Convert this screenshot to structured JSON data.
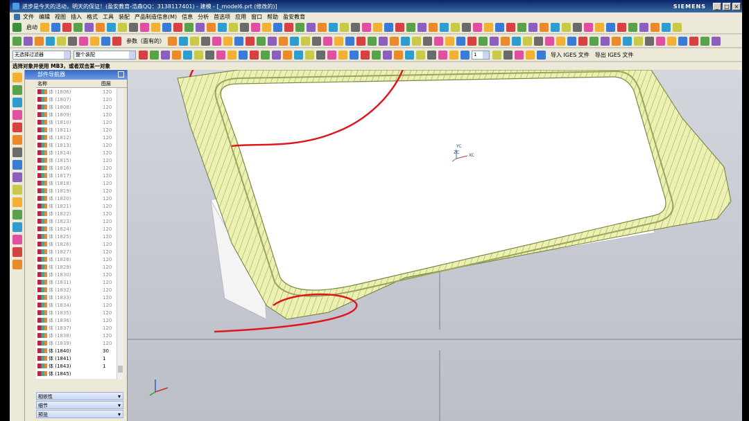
{
  "window": {
    "title": "进步是今天的活动，明天的保证！(盈安教育-浩森QQ：3138117401) - 建模 - [_model6.prt (修改的)]",
    "brand": "SIEMENS"
  },
  "menu": [
    "文件",
    "编辑",
    "视图",
    "插入",
    "格式",
    "工具",
    "装配",
    "产品制造信息(M)",
    "信息",
    "分析",
    "首选项",
    "应用",
    "窗口",
    "帮助",
    "盈安教育"
  ],
  "toolbar": {
    "start_label": "启动",
    "params_label": "参数（面有的）",
    "filter_value": "无选择过滤器",
    "assembly_value": "整个装配",
    "layer_value": "1",
    "import_iges": "导入 IGES 文件",
    "export_iges": "导出 IGES 文件"
  },
  "status_prompt": "选择对象并使用 MB3，或者双击某一对象",
  "navigator": {
    "title": "部件导航器",
    "col_name": "名称",
    "col_layer": "图层",
    "rows": [
      {
        "name": "体 (1806)",
        "layer": "120"
      },
      {
        "name": "体 (1807)",
        "layer": "120"
      },
      {
        "name": "体 (1808)",
        "layer": "120"
      },
      {
        "name": "体 (1809)",
        "layer": "120"
      },
      {
        "name": "体 (1810)",
        "layer": "120"
      },
      {
        "name": "体 (1811)",
        "layer": "120"
      },
      {
        "name": "体 (1812)",
        "layer": "120"
      },
      {
        "name": "体 (1813)",
        "layer": "120"
      },
      {
        "name": "体 (1814)",
        "layer": "120"
      },
      {
        "name": "体 (1815)",
        "layer": "120"
      },
      {
        "name": "体 (1816)",
        "layer": "120"
      },
      {
        "name": "体 (1817)",
        "layer": "120"
      },
      {
        "name": "体 (1818)",
        "layer": "120"
      },
      {
        "name": "体 (1819)",
        "layer": "120"
      },
      {
        "name": "体 (1820)",
        "layer": "120"
      },
      {
        "name": "体 (1821)",
        "layer": "120"
      },
      {
        "name": "体 (1822)",
        "layer": "120"
      },
      {
        "name": "体 (1823)",
        "layer": "120"
      },
      {
        "name": "体 (1824)",
        "layer": "120"
      },
      {
        "name": "体 (1825)",
        "layer": "120"
      },
      {
        "name": "体 (1826)",
        "layer": "120"
      },
      {
        "name": "体 (1827)",
        "layer": "120"
      },
      {
        "name": "体 (1828)",
        "layer": "120"
      },
      {
        "name": "体 (1829)",
        "layer": "120"
      },
      {
        "name": "体 (1830)",
        "layer": "120"
      },
      {
        "name": "体 (1831)",
        "layer": "120"
      },
      {
        "name": "体 (1832)",
        "layer": "120"
      },
      {
        "name": "体 (1833)",
        "layer": "120"
      },
      {
        "name": "体 (1834)",
        "layer": "120"
      },
      {
        "name": "体 (1835)",
        "layer": "120"
      },
      {
        "name": "体 (1836)",
        "layer": "120"
      },
      {
        "name": "体 (1837)",
        "layer": "120"
      },
      {
        "name": "体 (1838)",
        "layer": "120"
      },
      {
        "name": "体 (1839)",
        "layer": "120"
      },
      {
        "name": "体 (1840)",
        "layer": "30"
      },
      {
        "name": "体 (1841)",
        "layer": "1"
      },
      {
        "name": "体 (1843)",
        "layer": "1"
      },
      {
        "name": "体 (1845)",
        "layer": ""
      }
    ],
    "sections": [
      "相依性",
      "细节",
      "预览"
    ]
  },
  "view": {
    "wcs_x": "XC",
    "wcs_y": "YC",
    "wcs_z": "ZC"
  }
}
